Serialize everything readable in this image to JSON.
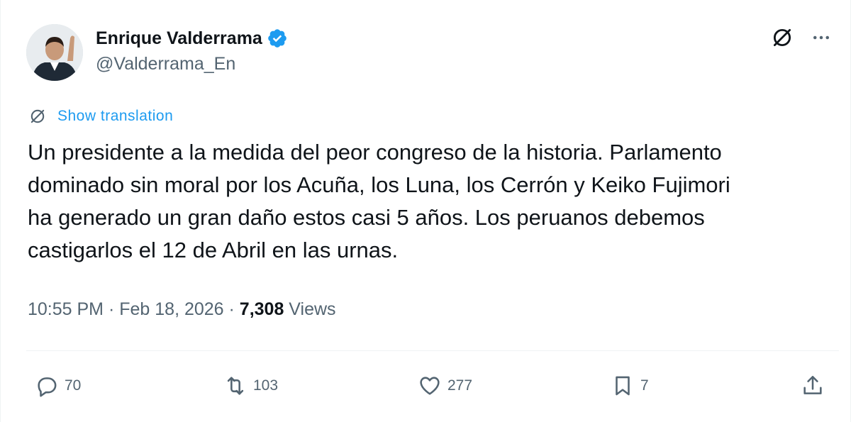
{
  "author": {
    "name": "Enrique Valderrama",
    "handle": "@Valderrama_En",
    "verified": true
  },
  "translate": {
    "label": "Show translation"
  },
  "tweet": {
    "text": "Un presidente a la medida del peor congreso de la historia. Parlamento\ndominado sin moral por los Acuña, los Luna, los Cerrón y Keiko Fujimori\nha generado un gran daño estos casi 5 años. Los peruanos debemos\ncastigarlos el 12 de Abril en las urnas."
  },
  "meta": {
    "time": "10:55 PM",
    "sep1": " · ",
    "date": "Feb 18, 2026",
    "sep2": " · ",
    "views_count": "7,308",
    "views_label": " Views"
  },
  "actions": {
    "replies": "70",
    "reposts": "103",
    "likes": "277",
    "bookmarks": "7"
  },
  "icons": {
    "verified": "verified-badge-icon",
    "grok": "grok-icon",
    "more": "more-icon",
    "reply": "reply-icon",
    "repost": "repost-icon",
    "like": "heart-icon",
    "bookmark": "bookmark-icon",
    "share": "share-icon"
  },
  "colors": {
    "accent": "#1d9bf0",
    "text": "#0f1419",
    "secondary": "#536471",
    "divider": "#eff3f4"
  }
}
